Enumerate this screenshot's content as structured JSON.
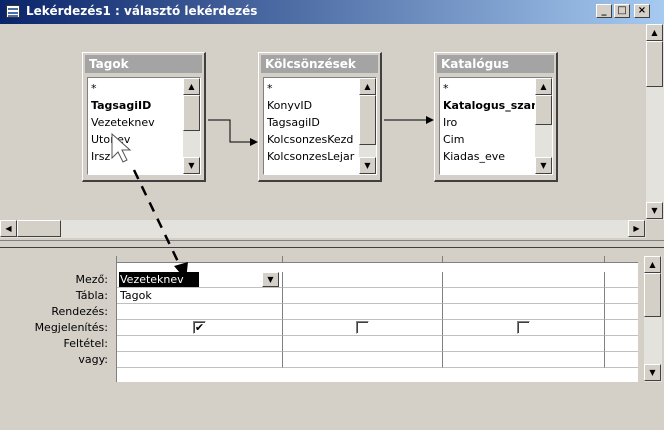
{
  "window": {
    "title": "Lekérdezés1 : választó lekérdezés",
    "minimize_glyph": "_",
    "maximize_glyph": "□",
    "close_glyph": "×"
  },
  "tables": [
    {
      "name": "Tagok",
      "fields": [
        {
          "label": "*",
          "bold": false
        },
        {
          "label": "TagsagiID",
          "bold": true
        },
        {
          "label": "Vezeteknev",
          "bold": false
        },
        {
          "label": "Utonev",
          "bold": false
        },
        {
          "label": "Irsz",
          "bold": false
        }
      ]
    },
    {
      "name": "Kölcsönzések",
      "fields": [
        {
          "label": "*",
          "bold": false
        },
        {
          "label": "KonyvID",
          "bold": false
        },
        {
          "label": "TagsagiID",
          "bold": false
        },
        {
          "label": "KolcsonzesKezd",
          "bold": false
        },
        {
          "label": "KolcsonzesLejar",
          "bold": false
        }
      ]
    },
    {
      "name": "Katalógus",
      "fields": [
        {
          "label": "*",
          "bold": false
        },
        {
          "label": "Katalogus_szam",
          "bold": true
        },
        {
          "label": "Iro",
          "bold": false
        },
        {
          "label": "Cim",
          "bold": false
        },
        {
          "label": "Kiadas_eve",
          "bold": false
        }
      ]
    }
  ],
  "grid": {
    "row_labels": [
      "Mező:",
      "Tábla:",
      "Rendezés:",
      "Megjelenítés:",
      "Feltétel:",
      "vagy:"
    ],
    "columns": [
      {
        "field": "Vezeteknev",
        "table": "Tagok",
        "sort": "",
        "show": true,
        "criteria": "",
        "or": ""
      },
      {
        "field": "",
        "table": "",
        "sort": "",
        "show": false,
        "criteria": "",
        "or": ""
      },
      {
        "field": "",
        "table": "",
        "sort": "",
        "show": false,
        "criteria": "",
        "or": ""
      }
    ]
  },
  "glyphs": {
    "check": "✔",
    "arrow_up": "▲",
    "arrow_down": "▼",
    "arrow_left": "◀",
    "arrow_right": "▶"
  },
  "icons": {
    "app": "datasheet-icon",
    "cursor": "drag-cursor-icon"
  },
  "colors": {
    "titlebar_start": "#0a246a",
    "titlebar_end": "#a6caf0",
    "field_list_title": "#a4a4a4",
    "face": "#d4d0c8"
  }
}
